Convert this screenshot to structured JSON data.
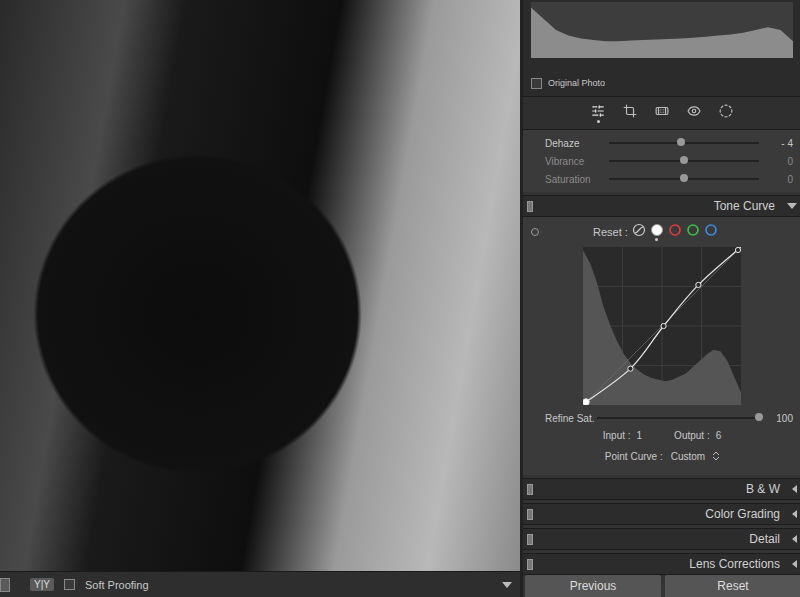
{
  "histogram": {
    "values": [
      0.9,
      0.7,
      0.5,
      0.4,
      0.35,
      0.32,
      0.3,
      0.3,
      0.31,
      0.32,
      0.33,
      0.34,
      0.35,
      0.36,
      0.38,
      0.4,
      0.42,
      0.45,
      0.5,
      0.55,
      0.5,
      0.3
    ],
    "label": "Original Photo",
    "checked": false
  },
  "tools": [
    {
      "selected": true
    },
    {
      "selected": false
    },
    {
      "selected": false
    },
    {
      "selected": false
    },
    {
      "selected": false
    }
  ],
  "sliders": [
    {
      "label": "Dehaze",
      "value": "- 4",
      "level": 0.48,
      "dimmed": false
    },
    {
      "label": "Vibrance",
      "value": "0",
      "level": 0.5,
      "dimmed": true
    },
    {
      "label": "Saturation",
      "value": "0",
      "level": 0.5,
      "dimmed": true
    }
  ],
  "panels": [
    {
      "title": "Tone Curve",
      "expanded": true
    },
    {
      "title": "B & W",
      "expanded": false
    },
    {
      "title": "Color Grading",
      "expanded": false
    },
    {
      "title": "Detail",
      "expanded": false
    },
    {
      "title": "Lens Corrections",
      "expanded": false
    }
  ],
  "tone_curve": {
    "reset_label": "Reset :",
    "channels": [
      {
        "kind": "parametric",
        "color": "#cccccc",
        "selected": false
      },
      {
        "kind": "point",
        "color": "#ffffff",
        "selected": true
      },
      {
        "kind": "point",
        "color": "#e03c3c",
        "selected": false
      },
      {
        "kind": "point",
        "color": "#3cc24a",
        "selected": false
      },
      {
        "kind": "point",
        "color": "#3a8fe0",
        "selected": false
      }
    ],
    "histogram": [
      0.98,
      0.9,
      0.78,
      0.62,
      0.5,
      0.4,
      0.32,
      0.26,
      0.22,
      0.19,
      0.17,
      0.16,
      0.15,
      0.16,
      0.18,
      0.2,
      0.24,
      0.28,
      0.32,
      0.35,
      0.34,
      0.28,
      0.18,
      0.08
    ],
    "points": [
      {
        "x": 0.0,
        "y": 0.006,
        "selected": true
      },
      {
        "x": 0.3,
        "y": 0.23,
        "selected": false
      },
      {
        "x": 0.51,
        "y": 0.5,
        "selected": false
      },
      {
        "x": 0.73,
        "y": 0.76,
        "selected": false
      },
      {
        "x": 1.0,
        "y": 1.0,
        "selected": false
      }
    ],
    "refine": {
      "label": "Refine Sat.",
      "value": "100",
      "level": 1.0
    },
    "input": {
      "label": "Input :",
      "value": "1"
    },
    "output": {
      "label": "Output :",
      "value": "6"
    },
    "point_curve": {
      "label": "Point Curve :",
      "value": "Custom"
    }
  },
  "buttons": [
    "Previous",
    "Reset"
  ],
  "toolbar": {
    "view_mode": "Y|Y",
    "soft_proofing": {
      "label": "Soft Proofing",
      "checked": false
    }
  }
}
